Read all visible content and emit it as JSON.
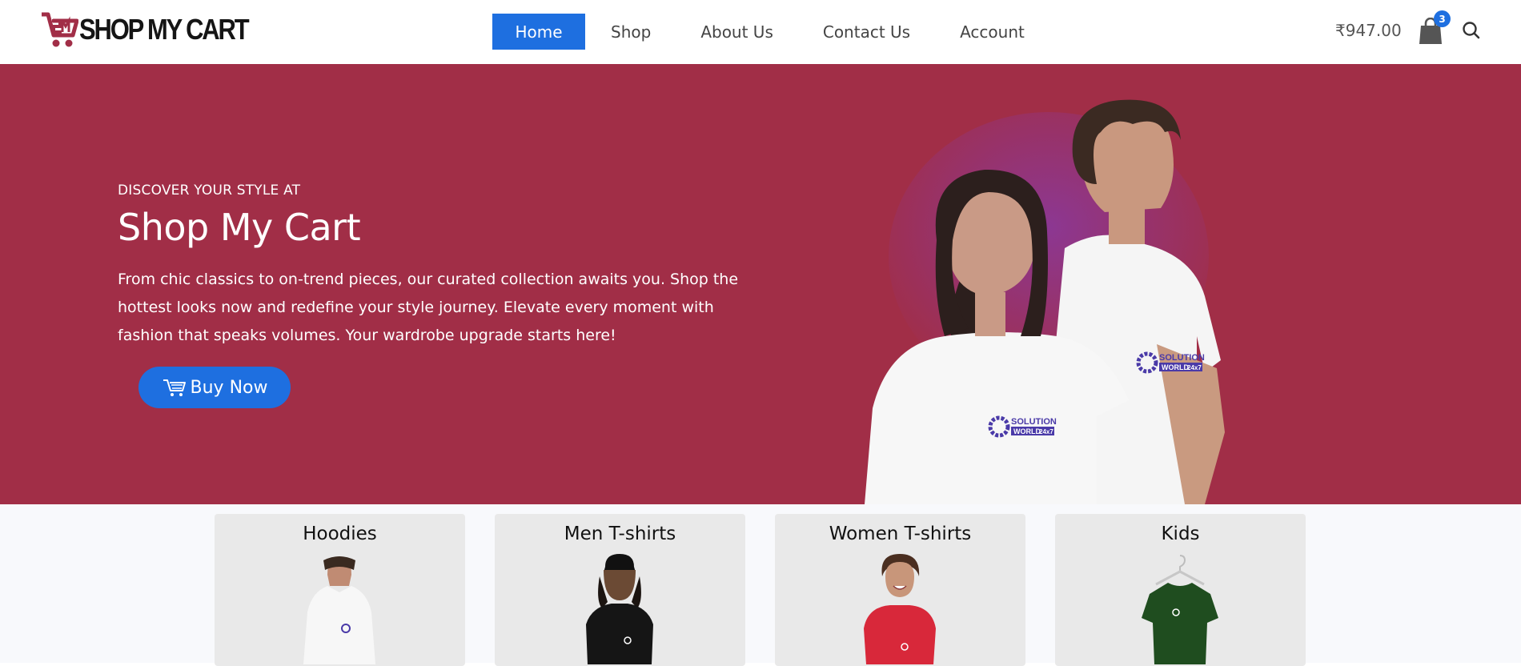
{
  "brand": {
    "name": "SHOP MY CART",
    "color": "#a12e47"
  },
  "nav": {
    "items": [
      {
        "label": "Home",
        "active": true
      },
      {
        "label": "Shop",
        "active": false
      },
      {
        "label": "About Us",
        "active": false
      },
      {
        "label": "Contact Us",
        "active": false
      },
      {
        "label": "Account",
        "active": false
      }
    ]
  },
  "cart": {
    "total": "₹947.00",
    "count": "3",
    "icon": "shopping-bag-icon"
  },
  "search": {
    "icon": "search-icon"
  },
  "hero": {
    "kicker": "DISCOVER YOUR STYLE AT",
    "title": "Shop My Cart",
    "copy": "From chic classics to on-trend pieces, our curated collection awaits you. Shop the hottest looks now and redefine your style journey. Elevate every moment with fashion that speaks volumes. Your wardrobe upgrade starts here!",
    "button_label": "Buy Now",
    "button_icon": "cart-icon",
    "background": "#a12e47",
    "accent": "#1e6fe0",
    "shirt_logo_text": [
      "SOLUTION",
      "WORLD",
      "24x7"
    ]
  },
  "categories": [
    {
      "title": "Hoodies",
      "product": "white hoodie"
    },
    {
      "title": "Men T-shirts",
      "product": "black t-shirt"
    },
    {
      "title": "Women T-shirts",
      "product": "red t-shirt"
    },
    {
      "title": "Kids",
      "product": "green t-shirt"
    }
  ]
}
